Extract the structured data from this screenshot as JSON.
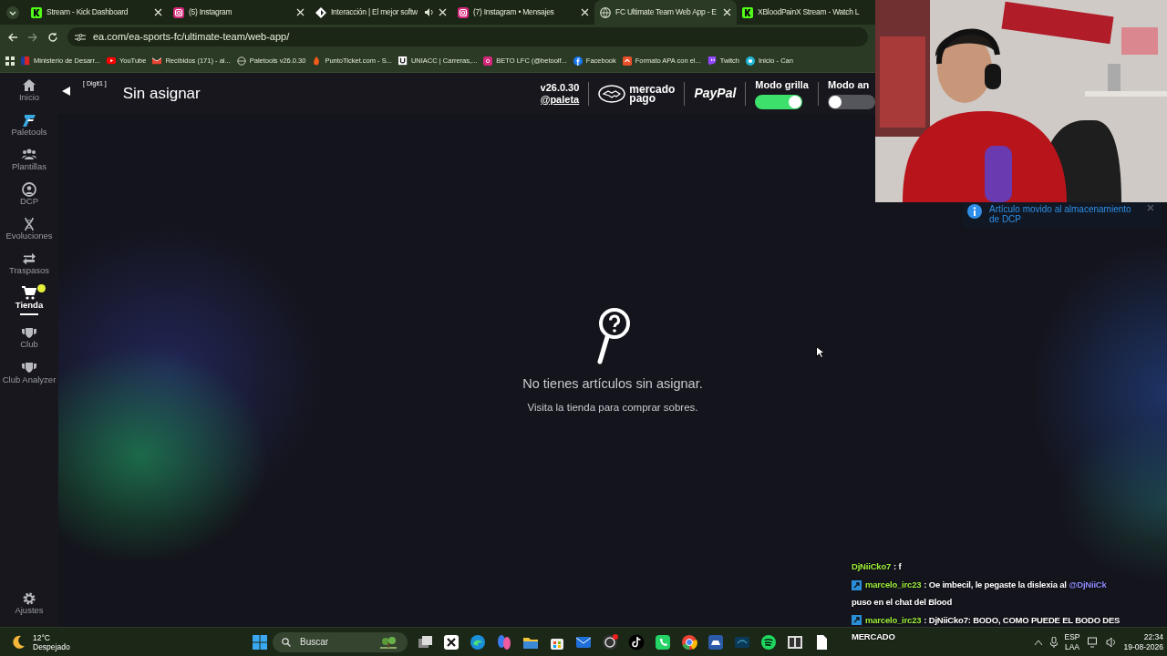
{
  "browser": {
    "tabs": [
      {
        "title": "Stream - Kick Dashboard",
        "selected": false,
        "playing_audio": false
      },
      {
        "title": "(5) Instagram",
        "selected": false,
        "playing_audio": false
      },
      {
        "title": "Interacción | El mejor softw",
        "selected": false,
        "playing_audio": true
      },
      {
        "title": "(7) Instagram • Mensajes",
        "selected": false,
        "playing_audio": false
      },
      {
        "title": "FC Ultimate Team Web App - E",
        "selected": true,
        "playing_audio": false
      },
      {
        "title": "XBloodPainX Stream - Watch L",
        "selected": false,
        "playing_audio": false
      }
    ],
    "address": "ea.com/ea-sports-fc/ultimate-team/web-app/",
    "bookmarks": [
      "Ministerio de Desarr...",
      "YouTube",
      "Recibidos (171) - al...",
      "Paletools v26.0.30",
      "PuntoTicket.com - S...",
      "UNIACC | Carreras,...",
      "BETO LFC (@betoolf...",
      "Facebook",
      "Formato APA con el...",
      "Twitch",
      "Inicio - Can"
    ]
  },
  "sidebar": {
    "items": [
      {
        "label": "Inicio",
        "selected": false,
        "notification": false
      },
      {
        "label": "Paletools",
        "selected": false,
        "notification": false
      },
      {
        "label": "Plantillas",
        "selected": false,
        "notification": false
      },
      {
        "label": "DCP",
        "selected": false,
        "notification": false
      },
      {
        "label": "Evoluciones",
        "selected": false,
        "notification": false
      },
      {
        "label": "Traspasos",
        "selected": false,
        "notification": false
      },
      {
        "label": "Tienda",
        "selected": true,
        "notification": true
      },
      {
        "label": "Club",
        "selected": false,
        "notification": false
      },
      {
        "label": "Club Analyzer",
        "selected": false,
        "notification": false
      }
    ],
    "settings": "Ajustes"
  },
  "header": {
    "key_hint": "[ Digit1 ]",
    "title": "Sin asignar",
    "version": "v26.0.30",
    "author": "@paleta",
    "mercado_pago": [
      "mercado",
      "pago"
    ],
    "paypal": "PayPal",
    "toggles": [
      {
        "label": "Modo grilla",
        "on": true
      },
      {
        "label": "Modo an",
        "on": false
      }
    ]
  },
  "empty_state": {
    "title": "No tienes artículos sin asignar.",
    "subtitle": "Visita la tienda para comprar sobres."
  },
  "toast": {
    "text": "Artículo movido al almacenamiento de DCP"
  },
  "chat": [
    {
      "user": "DjNiiCko7",
      "badge": false,
      "color": "#9ef03a",
      "parts": [
        {
          "text": ": f",
          "mention": false
        }
      ]
    },
    {
      "user": "marcelo_irc23",
      "badge": true,
      "color": "#9ef03a",
      "parts": [
        {
          "text": ": Oe imbecil, le pegaste la dislexia al ",
          "mention": false
        },
        {
          "text": "@DjNiiCk",
          "mention": true
        }
      ],
      "continuation": "puso en el chat del Blood"
    },
    {
      "user": "marcelo_irc23",
      "badge": true,
      "color": "#9ef03a",
      "parts": [
        {
          "text": ": DjNiiCko7: BODO, COMO PUEDE EL BODO DES",
          "mention": false
        }
      ],
      "continuation": "MERCADO"
    }
  ],
  "taskbar": {
    "temperature": "12°C",
    "weather": "Despejado",
    "search_placeholder": "Buscar",
    "language": "ESP",
    "layout": "LAA",
    "time": "22:34",
    "date": "19-08-2026"
  }
}
